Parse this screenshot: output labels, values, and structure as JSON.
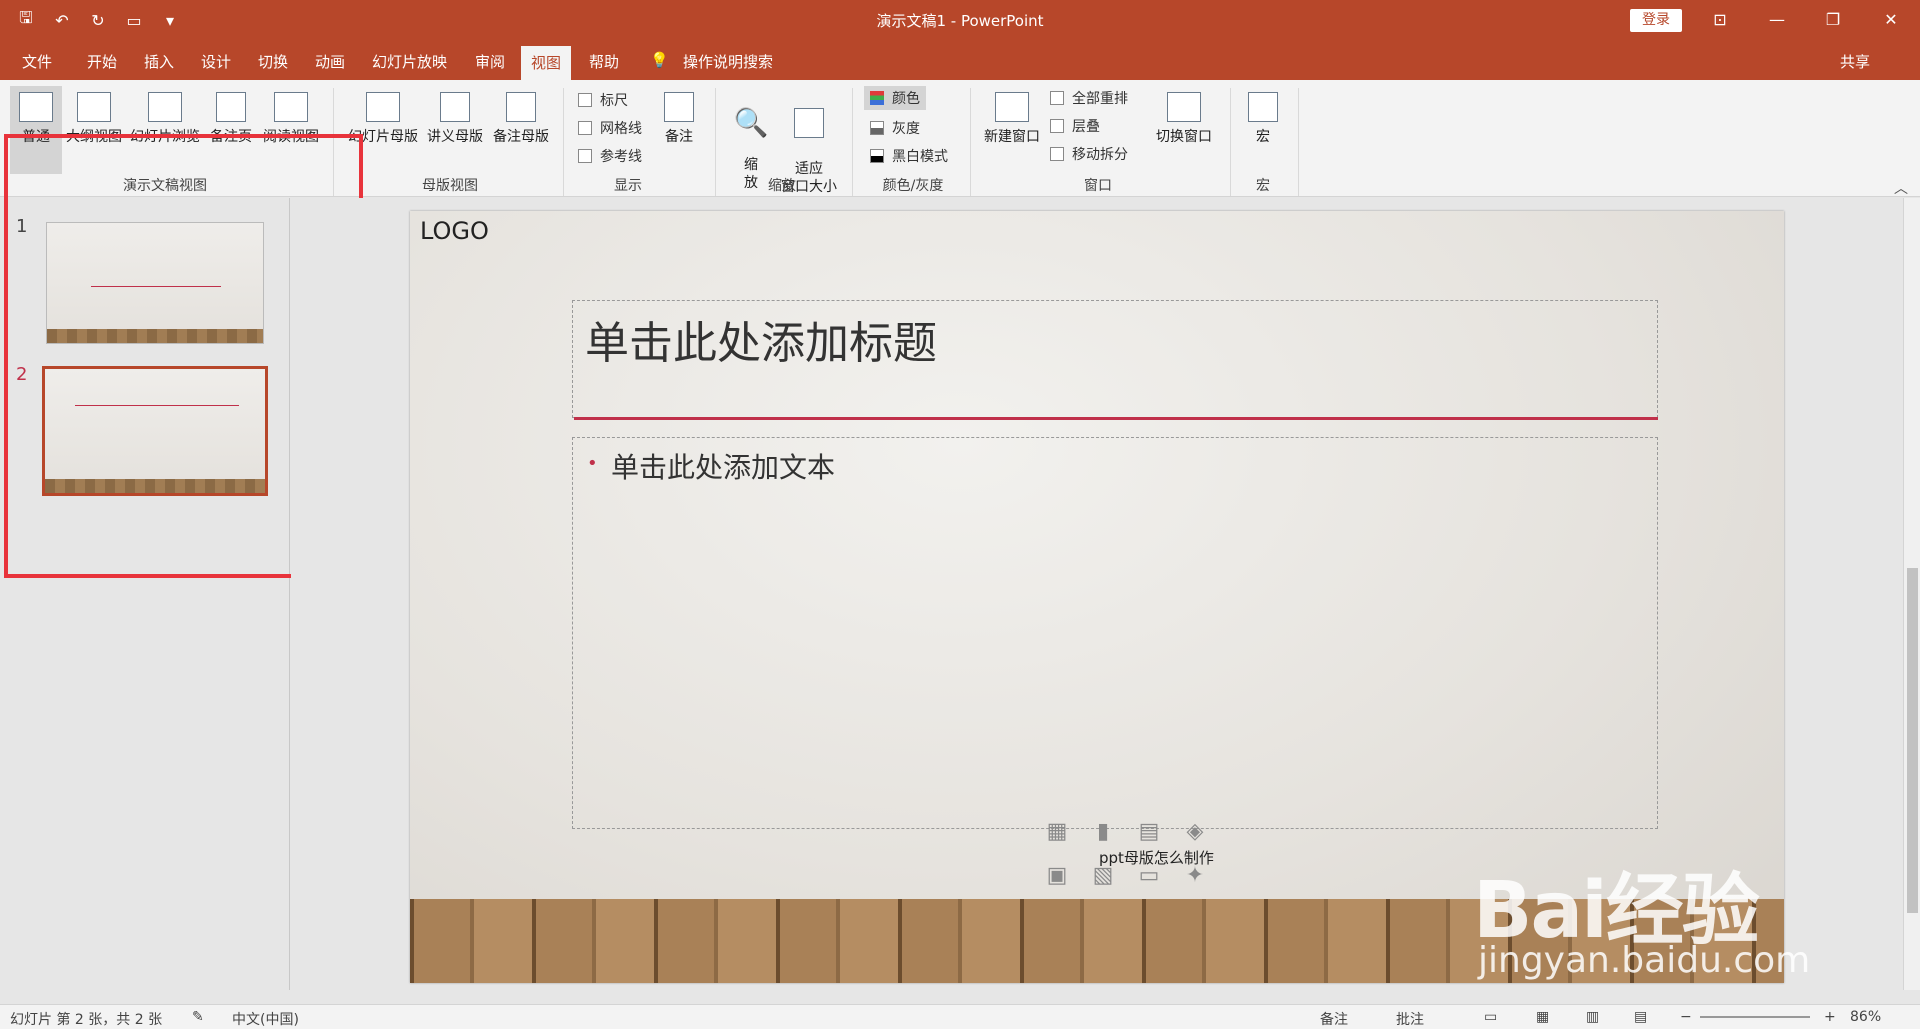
{
  "window": {
    "title": "演示文稿1  -  PowerPoint",
    "login": "登录"
  },
  "tabs": [
    {
      "label": "文件"
    },
    {
      "label": "开始"
    },
    {
      "label": "插入"
    },
    {
      "label": "设计"
    },
    {
      "label": "切换"
    },
    {
      "label": "动画"
    },
    {
      "label": "幻灯片放映"
    },
    {
      "label": "审阅"
    },
    {
      "label": "视图"
    },
    {
      "label": "帮助"
    },
    {
      "label": "操作说明搜索"
    }
  ],
  "share": "共享",
  "ribbon": {
    "presentation_views": [
      "普通",
      "大纲视图",
      "幻灯片浏览",
      "备注页",
      "阅读视图"
    ],
    "presentation_group": "演示文稿视图",
    "master_views": [
      "幻灯片母版",
      "讲义母版",
      "备注母版"
    ],
    "master_group": "母版视图",
    "show": {
      "ruler": "标尺",
      "gridlines": "网格线",
      "guides": "参考线",
      "notes": "备注",
      "group": "显示"
    },
    "zoom": {
      "zoom": "缩\n放",
      "fit": "适应\n窗口大小",
      "group": "缩放"
    },
    "color": {
      "color": "颜色",
      "gray": "灰度",
      "bw": "黑白模式",
      "group": "颜色/灰度"
    },
    "window": {
      "new": "新建窗口",
      "arrange": "全部重排",
      "cascade": "层叠",
      "split": "移动拆分",
      "switch": "切换窗口",
      "group": "窗口"
    },
    "macro": {
      "label": "宏",
      "group": "宏"
    }
  },
  "thumbnails": [
    "1",
    "2"
  ],
  "slide": {
    "logo": "LOGO",
    "title_placeholder": "单击此处添加标题",
    "body_placeholder": "单击此处添加文本",
    "caption": "ppt母版怎么制作"
  },
  "status": {
    "slide_info": "幻灯片 第 2 张，共 2 张",
    "lang": "中文(中国)",
    "notes": "备注",
    "comments": "批注",
    "zoom": "86%"
  },
  "watermark": {
    "brand": "Bai经验",
    "url": "jingyan.baidu.com"
  }
}
